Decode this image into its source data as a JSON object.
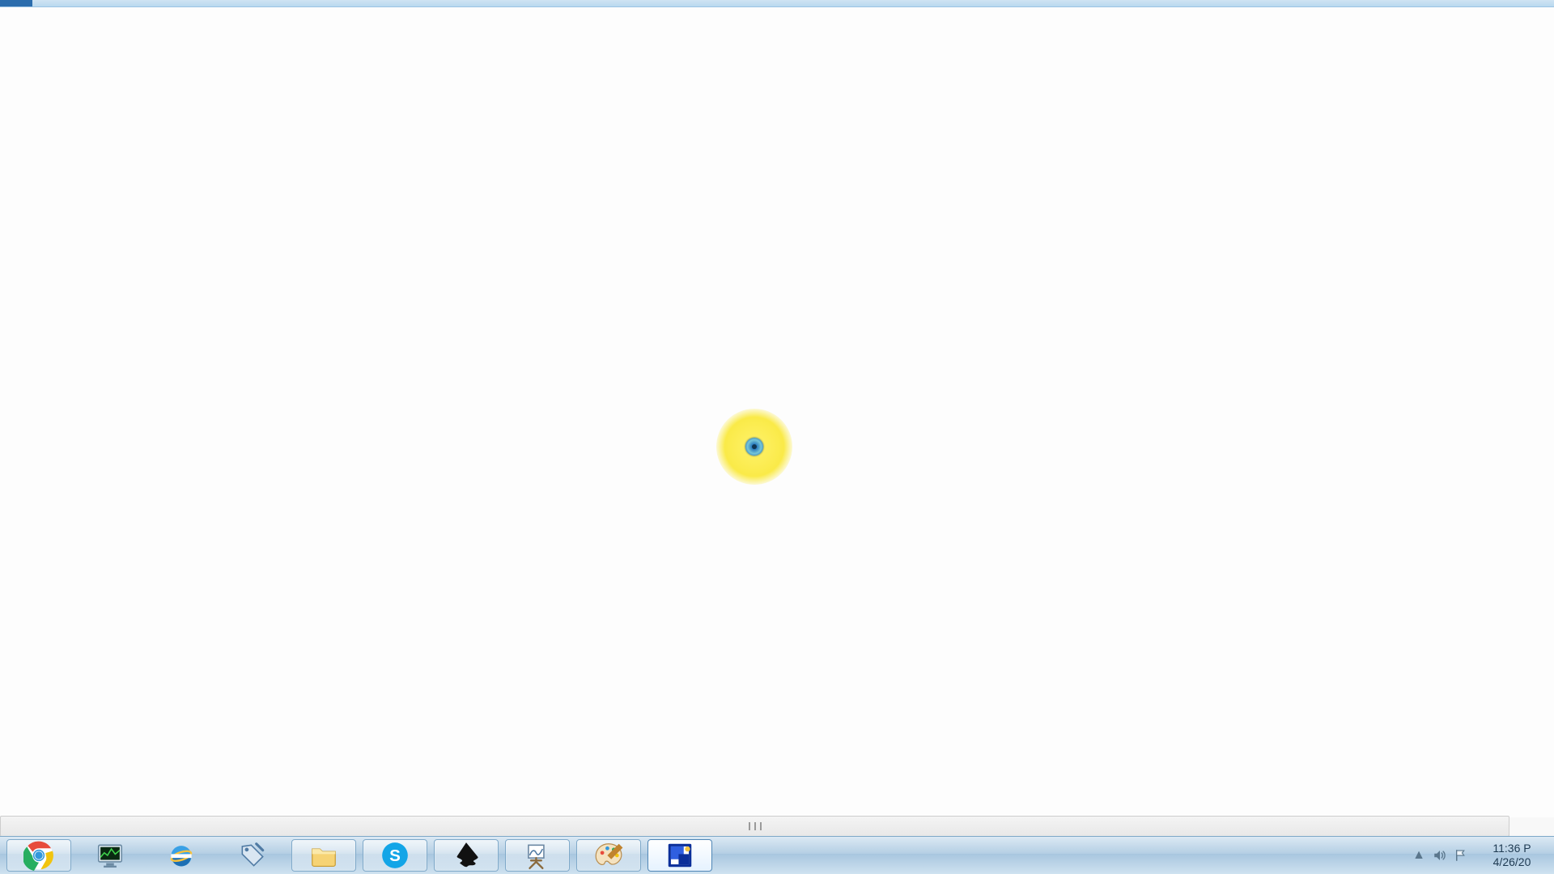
{
  "cursor": {
    "highlight_color": "#faea48",
    "ring_color": "#2a7bbf"
  },
  "taskbar": {
    "items": [
      {
        "name": "chrome",
        "running": true
      },
      {
        "name": "resource-monitor",
        "running": false
      },
      {
        "name": "internet-explorer",
        "running": false
      },
      {
        "name": "tag-tool",
        "running": false
      },
      {
        "name": "file-explorer",
        "running": true
      },
      {
        "name": "skype",
        "running": true
      },
      {
        "name": "inkscape",
        "running": true
      },
      {
        "name": "easel-app",
        "running": true
      },
      {
        "name": "mspaint",
        "running": true
      },
      {
        "name": "capture-tool",
        "running": true,
        "active": true
      }
    ]
  },
  "tray": {
    "show_hidden_label": "▲",
    "time": "11:36 P",
    "date": "4/26/20"
  }
}
